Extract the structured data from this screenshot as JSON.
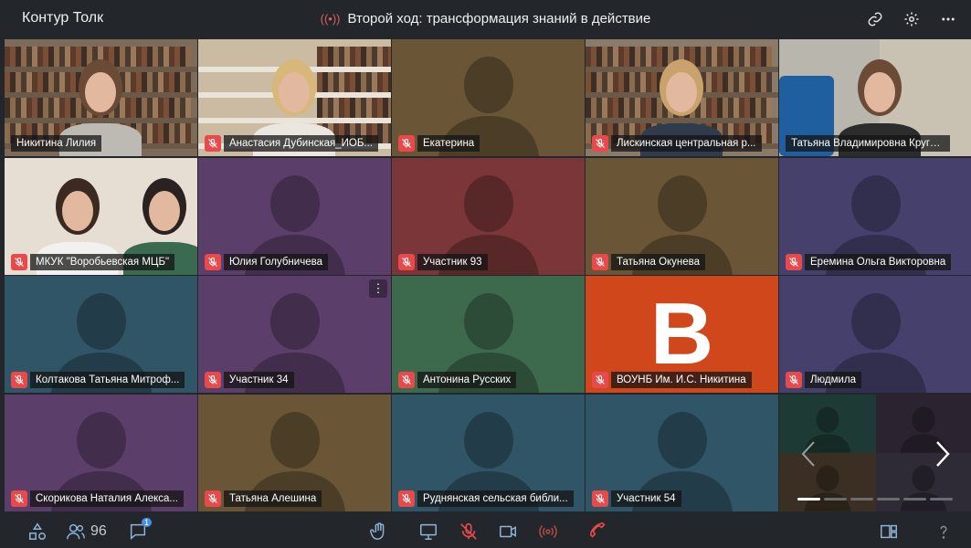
{
  "app": {
    "brand": "Контур Толк",
    "meeting_title": "Второй ход: трансформация знаний в действие"
  },
  "participants": [
    {
      "name": "Никитина Лилия",
      "muted": false,
      "type": "video",
      "bg": "#7d6a58"
    },
    {
      "name": "Анастасия Дубинская_ИОБ...",
      "muted": true,
      "type": "video",
      "bg": "#cbbba3"
    },
    {
      "name": "Екатерина",
      "muted": true,
      "type": "avatar",
      "bg": "#6a5536"
    },
    {
      "name": "Лискинская центральная р...",
      "muted": true,
      "type": "video",
      "bg": "#8a7a6a"
    },
    {
      "name": "Татьяна Владимировна Кругова",
      "muted": false,
      "type": "video",
      "bg": "#b9b6ae"
    },
    {
      "name": "МКУК \"Воробьевская МЦБ\"",
      "muted": true,
      "type": "video",
      "bg": "#d2cbc0"
    },
    {
      "name": "Юлия Голубничева",
      "muted": true,
      "type": "avatar",
      "bg": "#5b3e69"
    },
    {
      "name": "Участник 93",
      "muted": true,
      "type": "avatar",
      "bg": "#7a3638"
    },
    {
      "name": "Татьяна Окунева",
      "muted": true,
      "type": "avatar",
      "bg": "#6a5536"
    },
    {
      "name": "Еремина Ольга Викторовна",
      "muted": true,
      "type": "avatar",
      "bg": "#45406c"
    },
    {
      "name": "Колтакова Татьяна Митроф...",
      "muted": true,
      "type": "avatar",
      "bg": "#2f5566"
    },
    {
      "name": "Участник 34",
      "muted": true,
      "type": "avatar",
      "bg": "#5b3e69",
      "menu": true
    },
    {
      "name": "Антонина Русских",
      "muted": true,
      "type": "avatar",
      "bg": "#3d6a4c"
    },
    {
      "name": "ВОУНБ Им. И.С. Никитина",
      "muted": true,
      "type": "letter",
      "letter": "В",
      "bg": "#d0471c"
    },
    {
      "name": "Людмила",
      "muted": true,
      "type": "avatar",
      "bg": "#45406c"
    },
    {
      "name": "Скорикова Наталия Алекса...",
      "muted": true,
      "type": "avatar",
      "bg": "#5b3e69"
    },
    {
      "name": "Татьяна Алешина",
      "muted": true,
      "type": "avatar",
      "bg": "#6a5536"
    },
    {
      "name": "Руднянская сельская библи...",
      "muted": true,
      "type": "avatar",
      "bg": "#2f5566"
    },
    {
      "name": "Участник 54",
      "muted": true,
      "type": "avatar",
      "bg": "#2f5566"
    }
  ],
  "pager": {
    "page_count": 6,
    "active_page": 1
  },
  "bottombar": {
    "participants_count": "96",
    "chat_badge": "1"
  },
  "icons": [
    "link-icon",
    "settings-icon",
    "more-icon",
    "shapes-icon",
    "participants-icon",
    "chat-icon",
    "raise-hand-icon",
    "screen-share-icon",
    "mic-off-icon",
    "camera-icon",
    "broadcast-icon",
    "hangup-icon",
    "layout-icon",
    "help-icon"
  ]
}
